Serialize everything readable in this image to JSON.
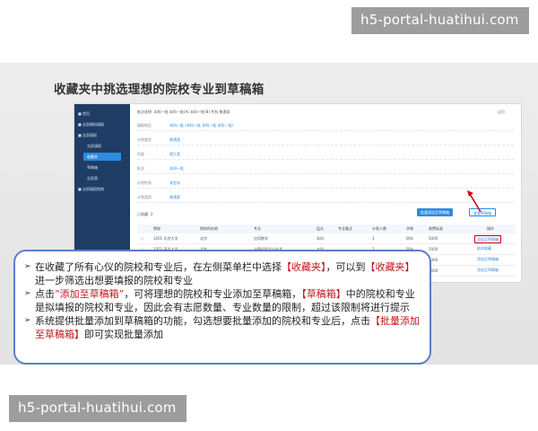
{
  "watermark": {
    "text": "h5-portal-huatihui.com"
  },
  "slide": {
    "title": "收藏夹中挑选理想的院校专业到草稿箱"
  },
  "screen": {
    "sidebar": {
      "items": [
        {
          "label": "■ 首页"
        },
        {
          "label": "■ 志愿模拟填报"
        },
        {
          "label": "■ 志愿填报"
        },
        {
          "label": "志愿填报"
        },
        {
          "label": "收藏夹"
        },
        {
          "label": "草稿箱"
        },
        {
          "label": "志愿表"
        },
        {
          "label": "■ 志愿填报指南"
        }
      ]
    },
    "filters": {
      "batch_line": "批次选择: 本科一批 本科一批(A) 本科一批(B) 专科 普通类",
      "rows": [
        {
          "label": "填报地区",
          "value": "本科一批 (本科一批 本科一批 本科一批)"
        },
        {
          "label": "计划类型",
          "value": "普通类"
        },
        {
          "label": "科类",
          "value": "理工类"
        },
        {
          "label": "批次",
          "value": "本科一批"
        },
        {
          "label": "计划性质",
          "value": "非定向"
        },
        {
          "label": "计划类别",
          "value": "普通类"
        }
      ],
      "right_label": "返回"
    },
    "total": "已收藏: 3",
    "buttons": {
      "batch_add": "批量添加至草稿箱",
      "show_draft": "查看草稿箱"
    },
    "table": {
      "headers": [
        "院校",
        "院校所在地",
        "专业",
        "层次",
        "专业备注",
        "计划人数",
        "学制",
        "收费标准",
        "操作"
      ],
      "rows": [
        [
          "1001 北京大学",
          "北京",
          "应用数学",
          "本科",
          "",
          "3",
          "四年",
          "5000"
        ],
        [
          "1002 清华大学",
          "北京",
          "计算机科学与技术",
          "本科",
          "",
          "2",
          "四年",
          "5000"
        ],
        [
          "1003 浙江大学",
          "浙江",
          "软件工程",
          "本科",
          "",
          "4",
          "四年",
          "5300"
        ],
        [
          "1004 复旦大学",
          "上海",
          "经济学",
          "本科",
          "",
          "2",
          "四年",
          "5000"
        ]
      ],
      "op_add": "添加至草稿箱",
      "op_cancel": "取消收藏"
    }
  },
  "callout": {
    "bullets": [
      [
        "在收藏了所有心仪的院校和专业后，在左侧菜单栏中选择",
        "【收藏夹】",
        "，可以到",
        "【收藏夹】",
        "进一步筛选出想要填报的院校和专业"
      ],
      [
        "点击",
        "“添加至草稿箱”",
        "，可将理想的院校和专业添加至草稿箱，",
        "【草稿箱】",
        "中的院校和专业是拟填报的院校和专业，因此会有志愿数量、专业数量的限制，超过该限制将进行提示"
      ],
      [
        "系统提供批量添加到草稿箱的功能，勾选想要批量添加的院校和专业后，点击",
        "【批量添加至草稿箱】",
        "即可实现批量添加"
      ]
    ]
  },
  "colors": {
    "accent": "#2d8ce0",
    "sidebar": "#1f3d64",
    "highlight": "#c0171b",
    "callout_border": "#5b7ec6"
  }
}
